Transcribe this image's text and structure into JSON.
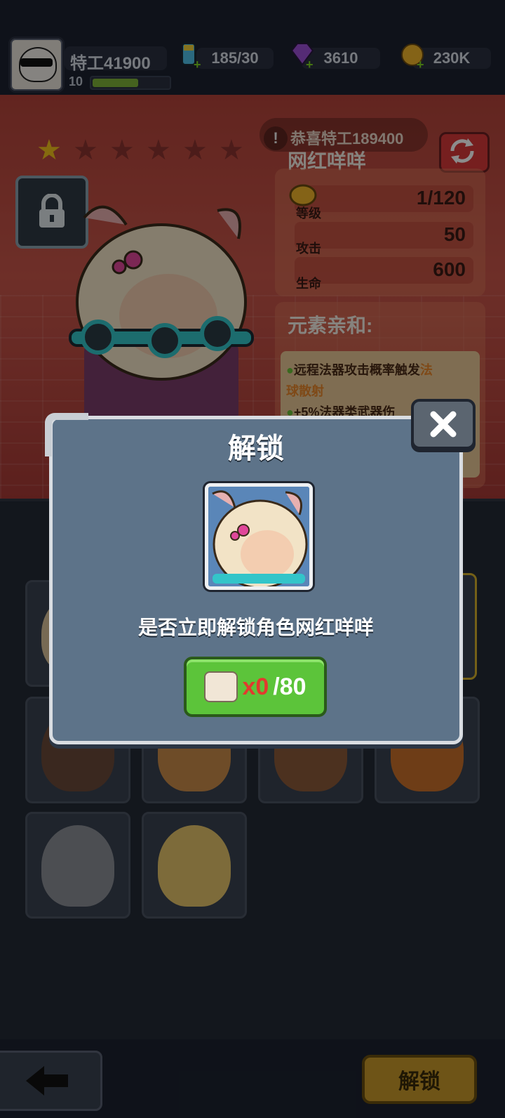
{
  "player": {
    "name": "特工41900",
    "level": "10",
    "xp_fraction": 0.6
  },
  "resources": {
    "energy": "185/30",
    "gems": "3610",
    "coins": "230K"
  },
  "hero": {
    "stars_filled": 1,
    "stars_total": 6,
    "ticker": "恭喜特工189400",
    "name": "网红咩咩",
    "stats": [
      {
        "label": "等级",
        "value": "1/120"
      },
      {
        "label": "攻击",
        "value": "50"
      },
      {
        "label": "生命",
        "value": "600"
      }
    ],
    "element_title": "元素亲和:",
    "element_lines": {
      "line1_prefix": "远程法器攻击概率触发",
      "line1_highlight": "法",
      "line2_highlight": "球散射",
      "line3": "+5%法器类武器伤"
    }
  },
  "modal": {
    "title": "解锁",
    "question": "是否立即解锁角色网红咩咩",
    "cost_have": "x0",
    "cost_need": "/80"
  },
  "bottom": {
    "unlock_label": "解锁"
  },
  "icons": {
    "close": "close-icon",
    "lock": "lock-icon",
    "back": "back-arrow-icon",
    "refresh": "refresh-icon"
  }
}
